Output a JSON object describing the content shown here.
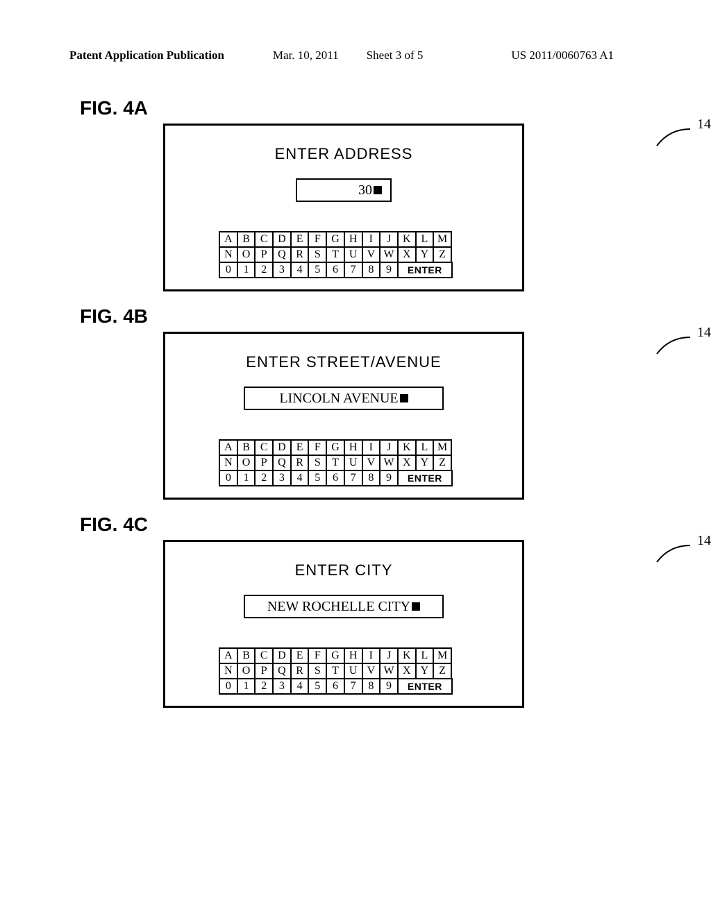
{
  "header": {
    "publication_label": "Patent Application Publication",
    "date": "Mar. 10, 2011",
    "sheet": "Sheet 3 of 5",
    "pub_number": "US 2011/0060763 A1"
  },
  "keyboard": {
    "row1": [
      "A",
      "B",
      "C",
      "D",
      "E",
      "F",
      "G",
      "H",
      "I",
      "J",
      "K",
      "L",
      "M"
    ],
    "row2": [
      "N",
      "O",
      "P",
      "Q",
      "R",
      "S",
      "T",
      "U",
      "V",
      "W",
      "X",
      "Y",
      "Z"
    ],
    "row3_nums": [
      "0",
      "1",
      "2",
      "3",
      "4",
      "5",
      "6",
      "7",
      "8",
      "9"
    ],
    "enter_label": "ENTER"
  },
  "figures": [
    {
      "id": "4A",
      "label": "FIG. 4A",
      "callout": "14",
      "title": "ENTER ADDRESS",
      "input_value": "30",
      "input_width": "narrow"
    },
    {
      "id": "4B",
      "label": "FIG. 4B",
      "callout": "14",
      "title": "ENTER STREET/AVENUE",
      "input_value": "LINCOLN AVENUE",
      "input_width": "wide"
    },
    {
      "id": "4C",
      "label": "FIG. 4C",
      "callout": "14",
      "title": "ENTER CITY",
      "input_value": "NEW ROCHELLE CITY",
      "input_width": "wide"
    }
  ]
}
